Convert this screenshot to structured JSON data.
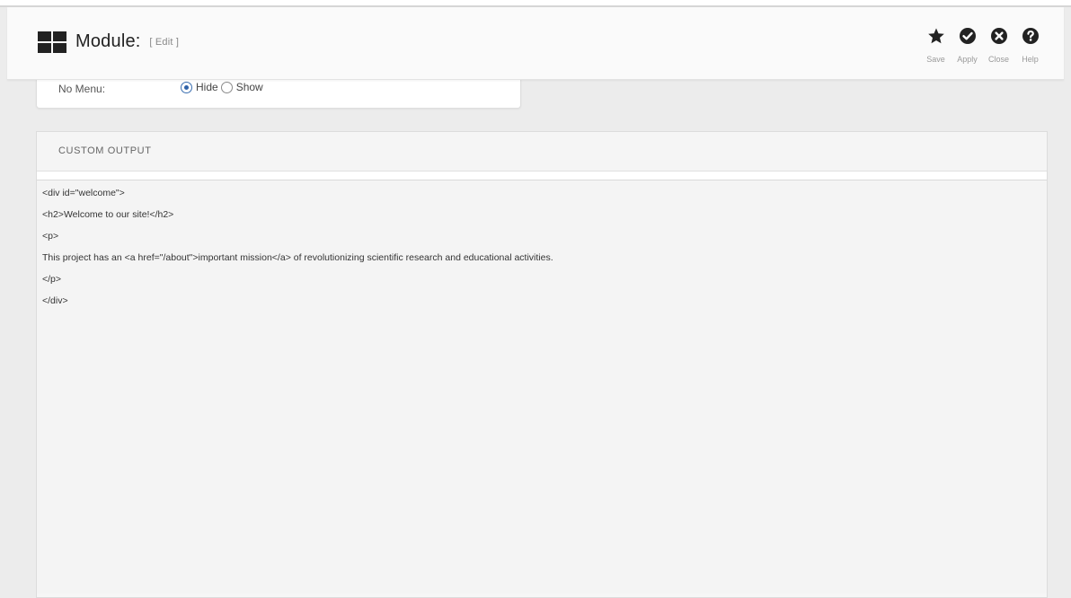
{
  "toolbar": {
    "title": "Module:",
    "task": "[ Edit ]",
    "actions": [
      {
        "icon": "star-icon",
        "label": "Save"
      },
      {
        "icon": "check-circle-icon",
        "label": "Apply"
      },
      {
        "icon": "close-circle-icon",
        "label": "Close"
      },
      {
        "icon": "help-circle-icon",
        "label": "Help"
      }
    ]
  },
  "options": {
    "label": "No Menu:",
    "choices": [
      {
        "label": "Hide",
        "checked": true
      },
      {
        "label": "Show",
        "checked": false
      }
    ]
  },
  "custom_output": {
    "title": "CUSTOM OUTPUT",
    "lines": [
      "<div id=\"welcome\">",
      "<h2>Welcome to our site!</h2>",
      "<p>",
      "This project has an <a href=\"/about\">important mission</a> of revolutionizing scientific research and educational activities.",
      "</p>",
      "</div>"
    ]
  }
}
